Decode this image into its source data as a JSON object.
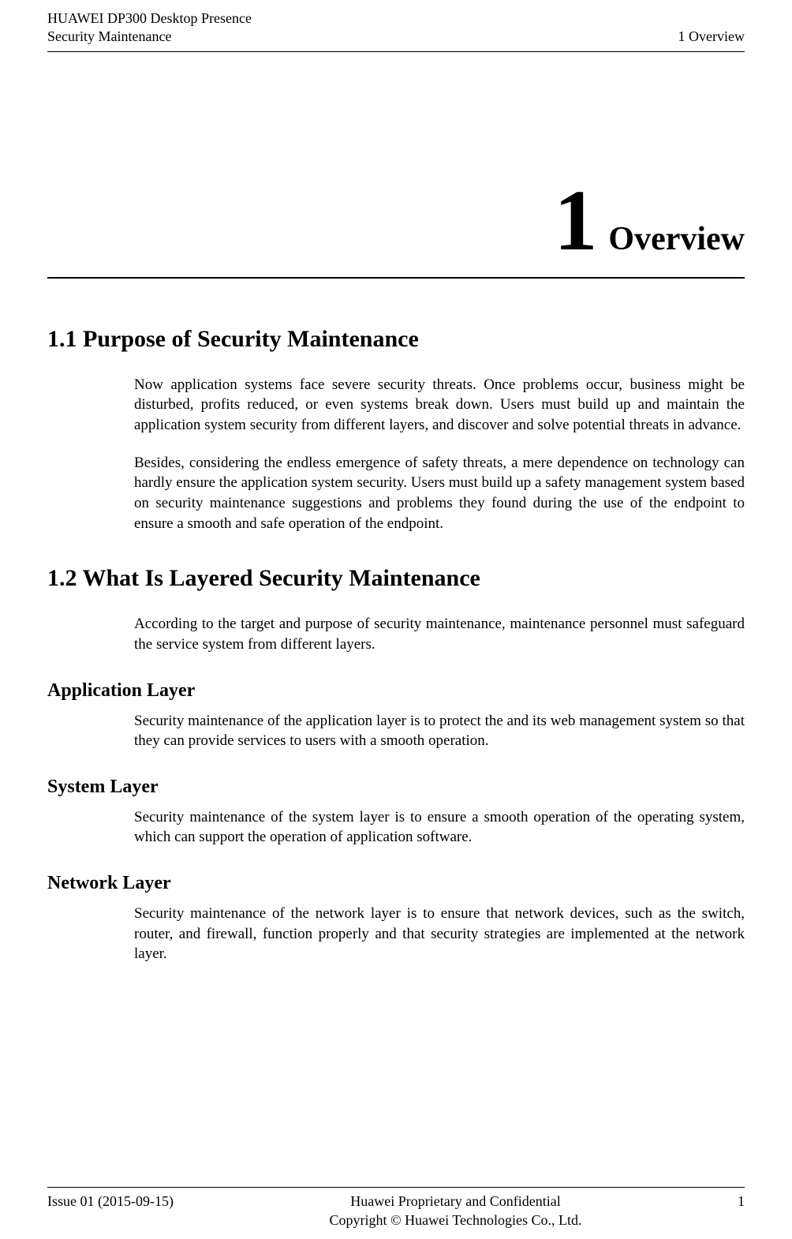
{
  "header": {
    "left_line1": "HUAWEI DP300 Desktop Presence",
    "left_line2": "Security Maintenance",
    "right": "1 Overview"
  },
  "chapter": {
    "number": "1",
    "word": "Overview"
  },
  "sections": {
    "s1_heading": "1.1 Purpose of Security Maintenance",
    "s1_p1": "Now application systems face severe security threats. Once problems occur, business might be disturbed, profits reduced, or even systems break down. Users must build up and maintain the application system security from different layers, and discover and solve potential threats in advance.",
    "s1_p2": "Besides, considering the endless emergence of safety threats, a mere dependence on technology can hardly ensure the application system security. Users must build up a safety management system based on security maintenance suggestions and problems they found during the use of the endpoint to ensure a smooth and safe operation of the endpoint.",
    "s2_heading": "1.2 What Is Layered Security Maintenance",
    "s2_p1": "According to the target and purpose of security maintenance, maintenance personnel must safeguard the service system from different layers.",
    "s2_sub1": "Application Layer",
    "s2_sub1_p": "Security maintenance of the application layer is to protect the and its web management system so that they can provide services to users with a smooth operation.",
    "s2_sub2": "System Layer",
    "s2_sub2_p": "Security maintenance of the system layer is to ensure a smooth operation of the operating system, which can support the operation of application software.",
    "s2_sub3": "Network Layer",
    "s2_sub3_p": "Security maintenance of the network layer is to ensure that network devices, such as the switch, router, and firewall, function properly and that security strategies are implemented at the network layer."
  },
  "footer": {
    "left": "Issue 01 (2015-09-15)",
    "center_line1": "Huawei Proprietary and Confidential",
    "center_line2": "Copyright © Huawei Technologies Co., Ltd.",
    "right": "1"
  }
}
